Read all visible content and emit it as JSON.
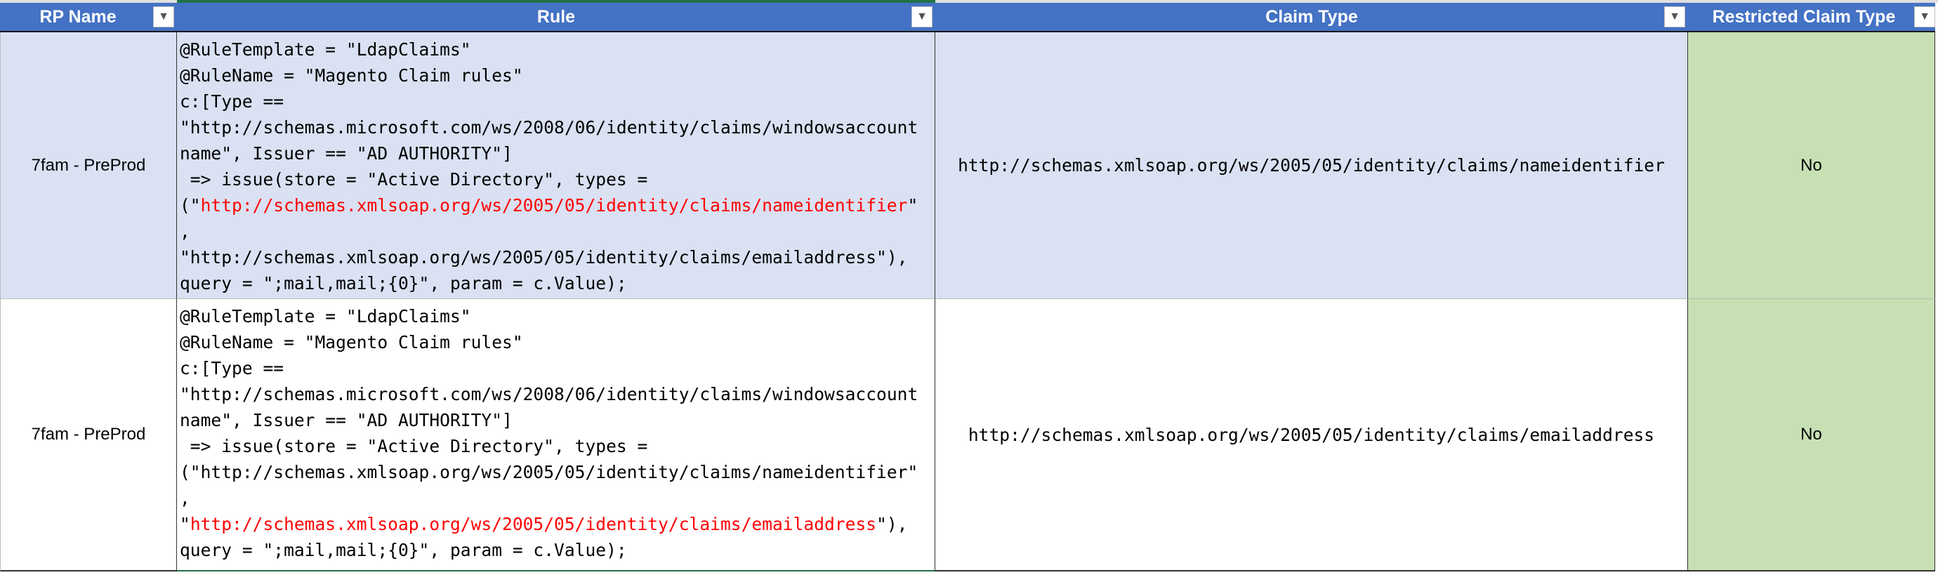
{
  "columns": [
    {
      "label": "RP Name"
    },
    {
      "label": "Rule"
    },
    {
      "label": "Claim Type"
    },
    {
      "label": "Restricted Claim Type"
    }
  ],
  "filter_icon": "dropdown-arrow-icon",
  "colors": {
    "header": "#4472C4",
    "band": "#D9E1F2",
    "restricted": "#C6E0B4",
    "highlight": "#FF0000"
  },
  "rows": [
    {
      "rp_name": "7fam - PreProd",
      "rule_lines": [
        "@RuleTemplate = \"LdapClaims\"",
        "@RuleName = \"Magento Claim rules\"",
        "c:[Type ==",
        "\"http://schemas.microsoft.com/ws/2008/06/identity/claims/windowsaccount",
        "name\", Issuer == \"AD AUTHORITY\"]",
        " => issue(store = \"Active Directory\", types =",
        "(\"",
        "http://schemas.xmlsoap.org/ws/2005/05/identity/claims/nameidentifier",
        "\"",
        ",",
        "\"http://schemas.xmlsoap.org/ws/2005/05/identity/claims/emailaddress\"),",
        "query = \";mail,mail;{0}\", param = c.Value);"
      ],
      "claim_type": "http://schemas.xmlsoap.org/ws/2005/05/identity/claims/nameidentifier",
      "restricted": "No"
    },
    {
      "rp_name": "7fam - PreProd",
      "rule_lines": [
        "@RuleTemplate = \"LdapClaims\"",
        "@RuleName = \"Magento Claim rules\"",
        "c:[Type ==",
        "\"http://schemas.microsoft.com/ws/2008/06/identity/claims/windowsaccount",
        "name\", Issuer == \"AD AUTHORITY\"]",
        " => issue(store = \"Active Directory\", types =",
        "(\"http://schemas.xmlsoap.org/ws/2005/05/identity/claims/nameidentifier\"",
        ",",
        "\"",
        "http://schemas.xmlsoap.org/ws/2005/05/identity/claims/emailaddress",
        "\"),",
        "query = \";mail,mail;{0}\", param = c.Value);"
      ],
      "claim_type": "http://schemas.xmlsoap.org/ws/2005/05/identity/claims/emailaddress",
      "restricted": "No"
    }
  ]
}
